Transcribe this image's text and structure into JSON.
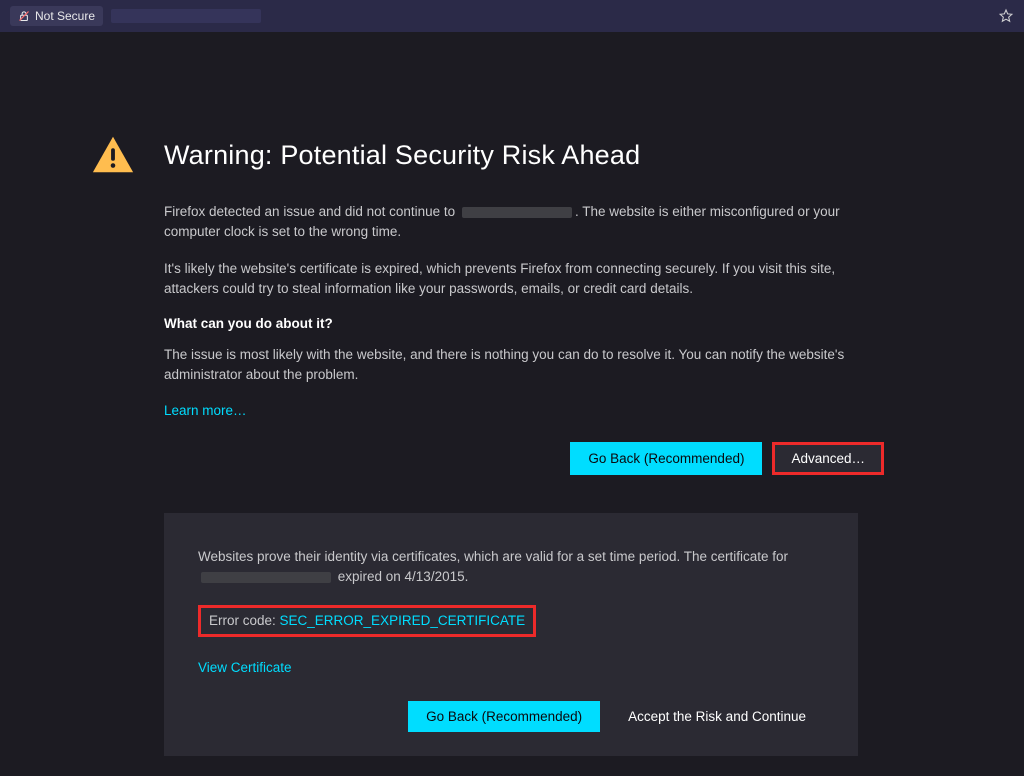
{
  "address_bar": {
    "not_secure_label": "Not Secure"
  },
  "warning": {
    "title": "Warning: Potential Security Risk Ahead",
    "para1_pre": "Firefox detected an issue and did not continue to ",
    "para1_post": ". The website is either misconfigured or your computer clock is set to the wrong time.",
    "para2": "It's likely the website's certificate is expired, which prevents Firefox from connecting securely. If you visit this site, attackers could try to steal information like your passwords, emails, or credit card details.",
    "subheading": "What can you do about it?",
    "para3": "The issue is most likely with the website, and there is nothing you can do to resolve it. You can notify the website's administrator about the problem.",
    "learn_more": "Learn more…"
  },
  "buttons": {
    "go_back": "Go Back (Recommended)",
    "advanced": "Advanced…",
    "accept_risk": "Accept the Risk and Continue"
  },
  "advanced_panel": {
    "cert_text_pre": "Websites prove their identity via certificates, which are valid for a set time period. The certificate for ",
    "cert_text_post": " expired on 4/13/2015.",
    "error_code_label": "Error code: ",
    "error_code_value": "SEC_ERROR_EXPIRED_CERTIFICATE",
    "view_certificate": "View Certificate"
  },
  "colors": {
    "accent": "#00ddff",
    "warning_icon": "#ffbd4f",
    "highlight": "#ed2a2a",
    "bg": "#1c1b22",
    "panel": "#2b2a33"
  }
}
